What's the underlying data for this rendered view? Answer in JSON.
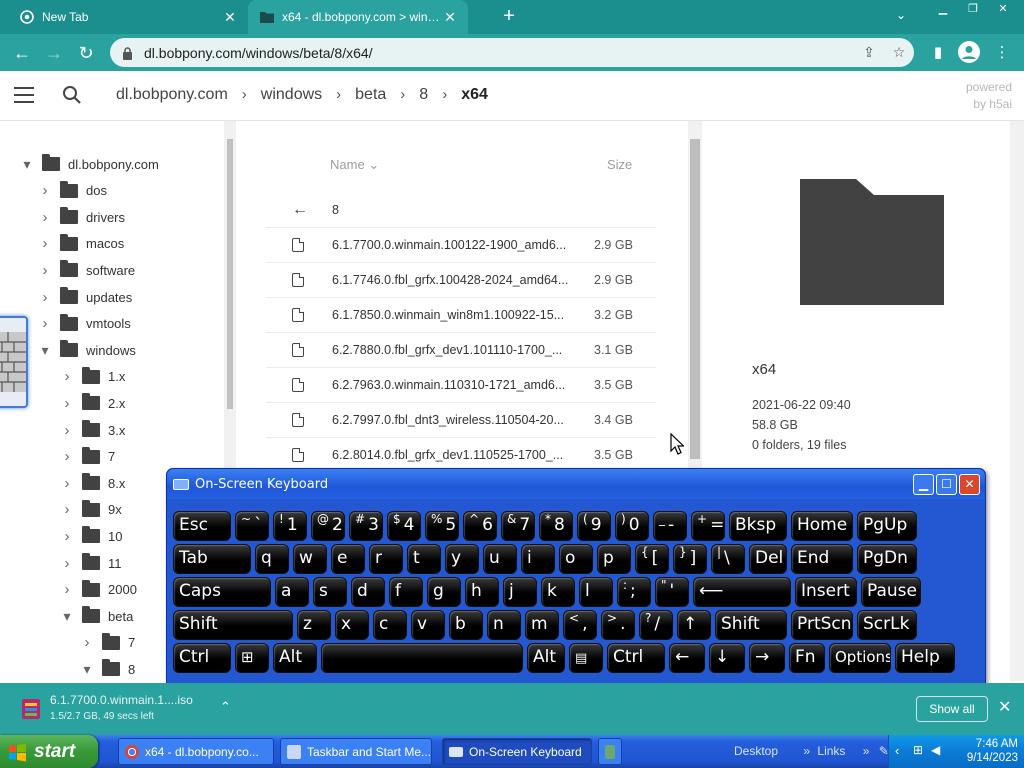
{
  "browser": {
    "tabs": [
      {
        "title": "New Tab",
        "active": false
      },
      {
        "title": "x64 - dl.bobpony.com > windows >",
        "active": true
      }
    ],
    "new_tab_glyph": "+",
    "url": "dl.bobpony.com/windows/beta/8/x64/"
  },
  "app": {
    "breadcrumb": [
      "dl.bobpony.com",
      "windows",
      "beta",
      "8",
      "x64"
    ],
    "powered_line1": "powered",
    "powered_line2": "by h5ai"
  },
  "tree": [
    {
      "label": "dl.bobpony.com",
      "depth": 0,
      "state": "open"
    },
    {
      "label": "dos",
      "depth": 1,
      "state": "closed"
    },
    {
      "label": "drivers",
      "depth": 1,
      "state": "closed"
    },
    {
      "label": "macos",
      "depth": 1,
      "state": "closed"
    },
    {
      "label": "software",
      "depth": 1,
      "state": "closed"
    },
    {
      "label": "updates",
      "depth": 1,
      "state": "closed"
    },
    {
      "label": "vmtools",
      "depth": 1,
      "state": "closed"
    },
    {
      "label": "windows",
      "depth": 1,
      "state": "open"
    },
    {
      "label": "1.x",
      "depth": 2,
      "state": "closed"
    },
    {
      "label": "2.x",
      "depth": 2,
      "state": "closed"
    },
    {
      "label": "3.x",
      "depth": 2,
      "state": "closed"
    },
    {
      "label": "7",
      "depth": 2,
      "state": "closed"
    },
    {
      "label": "8.x",
      "depth": 2,
      "state": "closed"
    },
    {
      "label": "9x",
      "depth": 2,
      "state": "closed"
    },
    {
      "label": "10",
      "depth": 2,
      "state": "closed"
    },
    {
      "label": "11",
      "depth": 2,
      "state": "closed"
    },
    {
      "label": "2000",
      "depth": 2,
      "state": "closed"
    },
    {
      "label": "beta",
      "depth": 2,
      "state": "open"
    },
    {
      "label": "7",
      "depth": 3,
      "state": "closed"
    },
    {
      "label": "8",
      "depth": 3,
      "state": "open"
    }
  ],
  "list": {
    "col_name": "Name",
    "col_size": "Size",
    "parent_label": "8",
    "files": [
      {
        "name": "6.1.7700.0.winmain.100122-1900_amd6...",
        "size": "2.9 GB"
      },
      {
        "name": "6.1.7746.0.fbl_grfx.100428-2024_amd64...",
        "size": "2.9 GB"
      },
      {
        "name": "6.1.7850.0.winmain_win8m1.100922-15...",
        "size": "3.2 GB"
      },
      {
        "name": "6.2.7880.0.fbl_grfx_dev1.101110-1700_...",
        "size": "3.1 GB"
      },
      {
        "name": "6.2.7963.0.winmain.110310-1721_amd6...",
        "size": "3.5 GB"
      },
      {
        "name": "6.2.7997.0.fbl_dnt3_wireless.110504-20...",
        "size": "3.4 GB"
      },
      {
        "name": "6.2.8014.0.fbl_grfx_dev1.110525-1700_...",
        "size": "3.5 GB"
      }
    ]
  },
  "details": {
    "name": "x64",
    "date": "2021-06-22 09:40",
    "size": "58.8 GB",
    "counts": "0 folders, 19 files"
  },
  "osk": {
    "title": "On-Screen Keyboard",
    "rows": [
      [
        {
          "label": "Esc"
        },
        {
          "sup": "~",
          "main": "`"
        },
        {
          "sup": "!",
          "main": "1"
        },
        {
          "sup": "@",
          "main": "2"
        },
        {
          "sup": "#",
          "main": "3"
        },
        {
          "sup": "$",
          "main": "4"
        },
        {
          "sup": "%",
          "main": "5"
        },
        {
          "sup": "^",
          "main": "6"
        },
        {
          "sup": "&",
          "main": "7"
        },
        {
          "sup": "*",
          "main": "8"
        },
        {
          "sup": "(",
          "main": "9"
        },
        {
          "sup": ")",
          "main": "0"
        },
        {
          "sup": "_",
          "main": "-"
        },
        {
          "sup": "+",
          "main": "="
        },
        {
          "label": "Bksp"
        },
        {
          "label": "Home"
        },
        {
          "label": "PgUp"
        }
      ],
      [
        {
          "label": "Tab"
        },
        {
          "label": "q"
        },
        {
          "label": "w"
        },
        {
          "label": "e"
        },
        {
          "label": "r"
        },
        {
          "label": "t"
        },
        {
          "label": "y"
        },
        {
          "label": "u"
        },
        {
          "label": "i"
        },
        {
          "label": "o"
        },
        {
          "label": "p"
        },
        {
          "sup": "{",
          "main": "["
        },
        {
          "sup": "}",
          "main": "]"
        },
        {
          "sup": "|",
          "main": "\\"
        },
        {
          "label": "Del"
        },
        {
          "label": "End"
        },
        {
          "label": "PgDn"
        }
      ],
      [
        {
          "label": "Caps"
        },
        {
          "label": "a"
        },
        {
          "label": "s"
        },
        {
          "label": "d"
        },
        {
          "label": "f"
        },
        {
          "label": "g"
        },
        {
          "label": "h"
        },
        {
          "label": "j"
        },
        {
          "label": "k"
        },
        {
          "label": "l"
        },
        {
          "sup": ":",
          "main": ";"
        },
        {
          "sup": "\"",
          "main": "'"
        },
        {
          "label": "⟵"
        },
        {
          "label": "Insert"
        },
        {
          "label": "Pause"
        }
      ],
      [
        {
          "label": "Shift"
        },
        {
          "label": "z"
        },
        {
          "label": "x"
        },
        {
          "label": "c"
        },
        {
          "label": "v"
        },
        {
          "label": "b"
        },
        {
          "label": "n"
        },
        {
          "label": "m"
        },
        {
          "sup": "<",
          "main": ","
        },
        {
          "sup": ">",
          "main": "."
        },
        {
          "sup": "?",
          "main": "/"
        },
        {
          "label": "↑"
        },
        {
          "label": "Shift"
        },
        {
          "label": "PrtScn"
        },
        {
          "label": "ScrLk"
        }
      ],
      [
        {
          "label": "Ctrl"
        },
        {
          "label": "win"
        },
        {
          "label": "Alt"
        },
        {
          "label": ""
        },
        {
          "label": "Alt"
        },
        {
          "label": "menu"
        },
        {
          "label": "Ctrl"
        },
        {
          "label": "←"
        },
        {
          "label": "↓"
        },
        {
          "label": "→"
        },
        {
          "label": "Fn"
        },
        {
          "label": "Options"
        },
        {
          "label": "Help"
        }
      ]
    ]
  },
  "download": {
    "name": "6.1.7700.0.winmain.1....iso",
    "status": "1.5/2.7 GB, 49 secs left",
    "show_all": "Show all"
  },
  "taskbar": {
    "start": "start",
    "tasks": [
      {
        "label": "x64 - dl.bobpony.co...",
        "icon": "chrome-icon"
      },
      {
        "label": "Taskbar and Start Me...",
        "icon": "taskbar-properties-icon"
      },
      {
        "label": "On-Screen Keyboard",
        "icon": "keyboard-icon"
      },
      {
        "label": "",
        "icon": "app-icon"
      }
    ],
    "desktop": "Desktop",
    "links": "Links",
    "time": "7:46 AM",
    "date": "9/14/2023"
  },
  "colors": {
    "chrome_theme": "#2aa29f",
    "xp_blue": "#245edb",
    "osk_blue": "#2458d2",
    "start_green": "#3a9b3a"
  }
}
